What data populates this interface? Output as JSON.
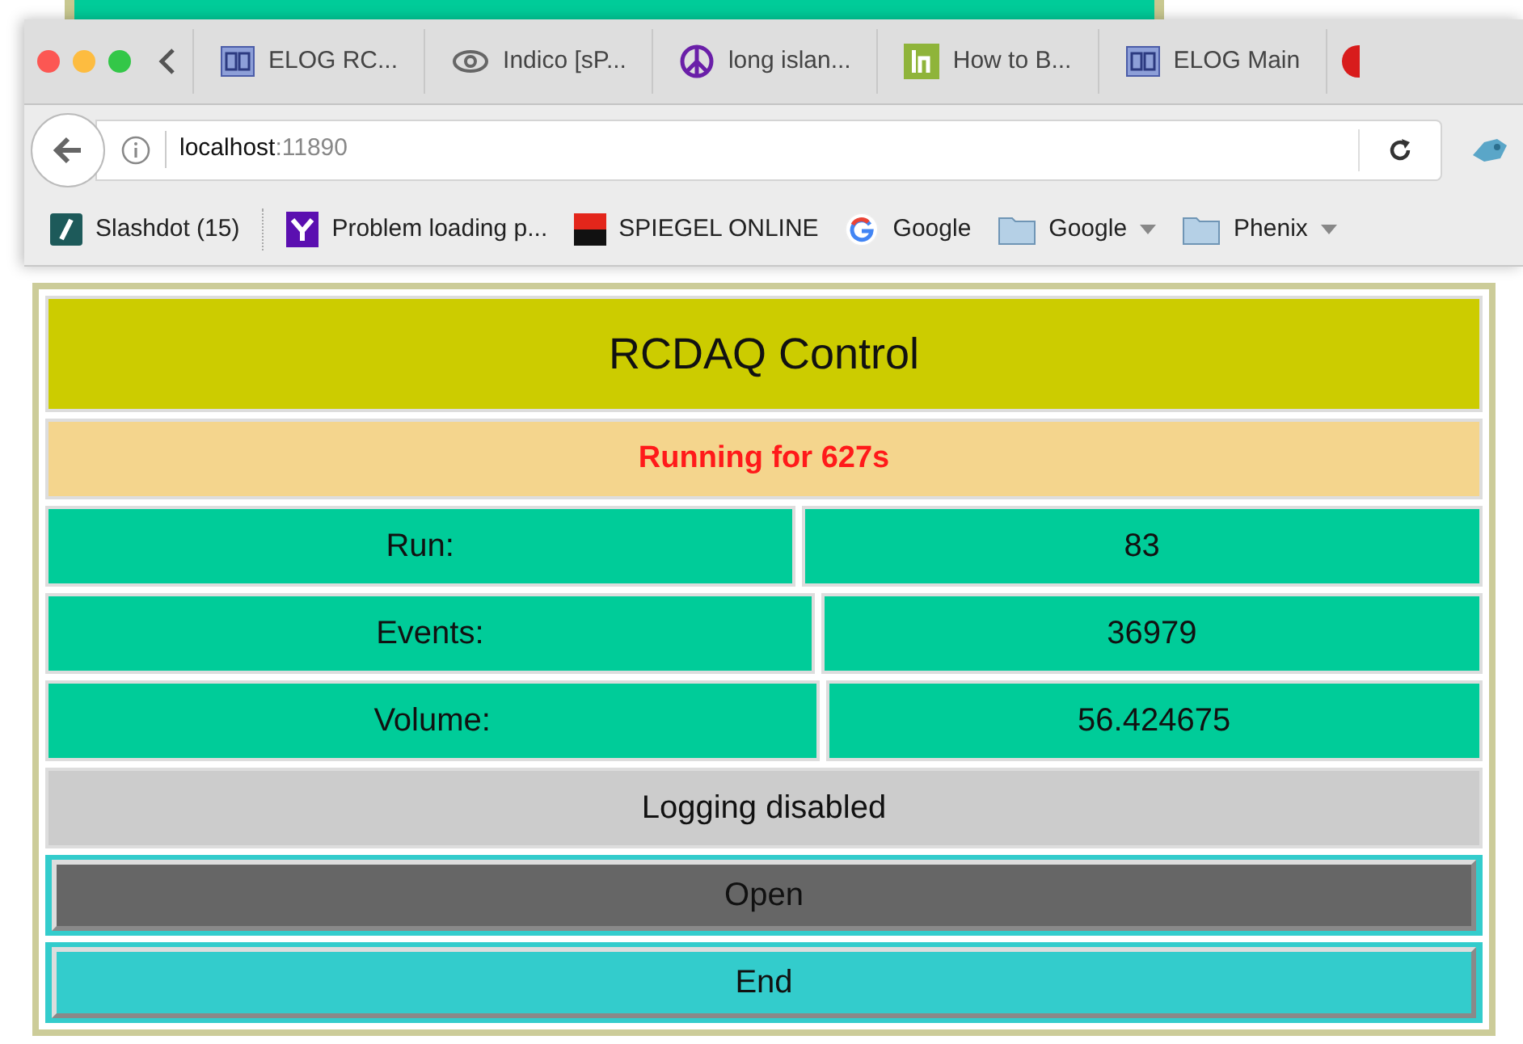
{
  "browser": {
    "tabs": [
      {
        "kind": "elog",
        "label": "ELOG RC..."
      },
      {
        "kind": "indico",
        "label": "Indico [sP..."
      },
      {
        "kind": "peace",
        "label": "long islan..."
      },
      {
        "kind": "lh",
        "label": "How to B..."
      },
      {
        "kind": "elog",
        "label": "ELOG Main"
      },
      {
        "kind": "dot"
      }
    ],
    "address": {
      "host": "localhost",
      "port": ":11890"
    },
    "bookmarks": [
      {
        "kind": "slashdot",
        "label": "Slashdot (15)"
      },
      {
        "kind": "yahoo",
        "label": "Problem loading p..."
      },
      {
        "kind": "spiegel",
        "label": "SPIEGEL ONLINE"
      },
      {
        "kind": "google",
        "label": "Google"
      },
      {
        "kind": "folder",
        "label": "Google"
      },
      {
        "kind": "folder",
        "label": "Phenix"
      }
    ]
  },
  "panel": {
    "title": "RCDAQ Control",
    "status": "Running for 627s",
    "fields": [
      {
        "label": "Run:",
        "value": "83"
      },
      {
        "label": "Events:",
        "value": "36979"
      },
      {
        "label": "Volume:",
        "value": "56.424675"
      }
    ],
    "logging": "Logging disabled",
    "buttons": [
      {
        "label": "Open",
        "color": "#666666"
      },
      {
        "label": "End",
        "color": "#33cccc"
      }
    ]
  }
}
